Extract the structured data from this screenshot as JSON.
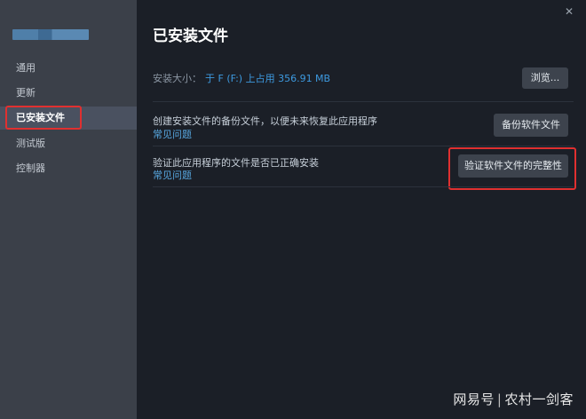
{
  "sidebar": {
    "items": [
      {
        "label": "通用",
        "active": false
      },
      {
        "label": "更新",
        "active": false
      },
      {
        "label": "已安装文件",
        "active": true
      },
      {
        "label": "测试版",
        "active": false
      },
      {
        "label": "控制器",
        "active": false
      }
    ]
  },
  "window": {
    "close_glyph": "✕"
  },
  "main": {
    "title": "已安装文件",
    "install_size": {
      "label": "安装大小：",
      "value": "于 F (F:) 上占用 356.91 MB",
      "browse_label": "浏览..."
    },
    "backup": {
      "text": "创建安装文件的备份文件，以便未来恢复此应用程序",
      "faq": "常见问题",
      "button_label": "备份软件文件"
    },
    "verify": {
      "text": "验证此应用程序的文件是否已正确安装",
      "faq": "常见问题",
      "button_label": "验证软件文件的完整性"
    }
  },
  "watermark": {
    "left": "网易号",
    "right": "农村一剑客"
  },
  "colors": {
    "sidebar_bg": "#3b4049",
    "main_bg": "#1b1f27",
    "accent_link": "#57a7e0",
    "highlight_red": "#e03030"
  }
}
